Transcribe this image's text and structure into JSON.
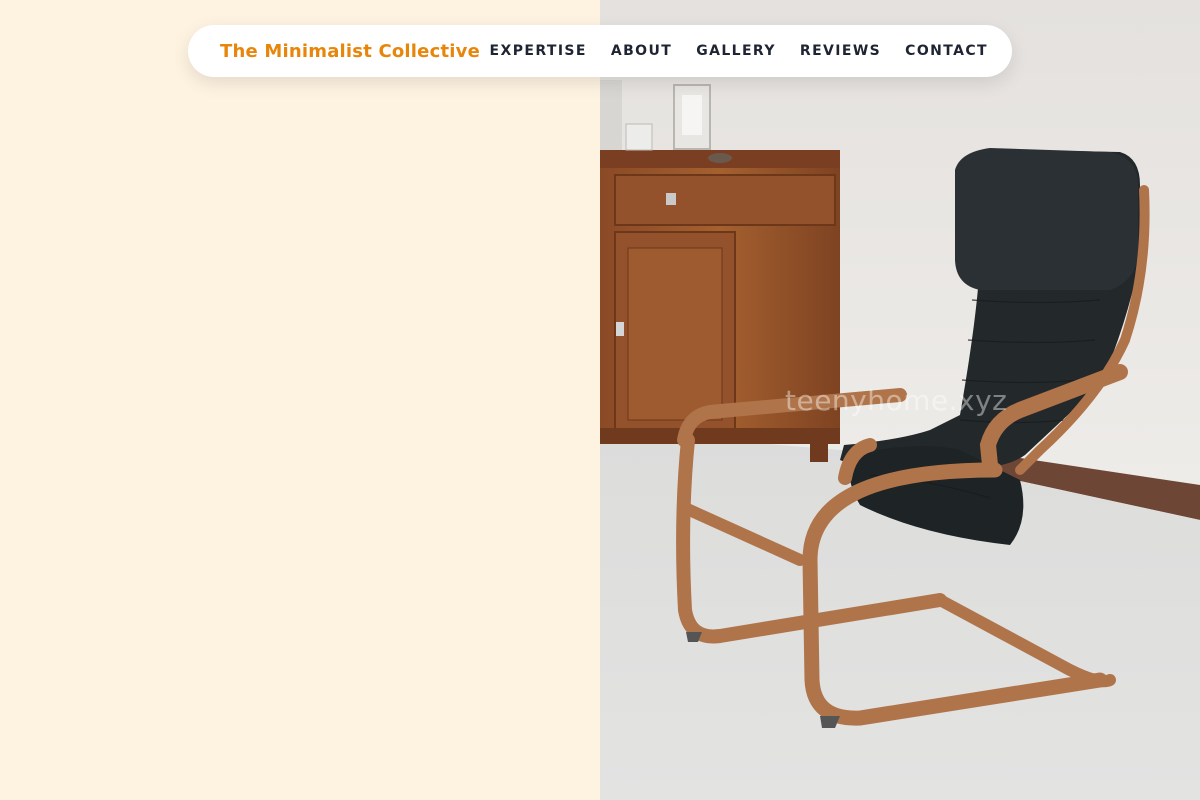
{
  "header": {
    "brand": "The Minimalist Collective",
    "nav": [
      {
        "label": "EXPERTISE"
      },
      {
        "label": "ABOUT"
      },
      {
        "label": "GALLERY"
      },
      {
        "label": "REVIEWS"
      },
      {
        "label": "CONTACT"
      }
    ]
  },
  "hero": {
    "watermark": "teenyhome.xyz"
  },
  "colors": {
    "brand": "#e8860c",
    "nav_text": "#1f2433",
    "left_panel_bg": "#fef2e1",
    "nav_bg": "#ffffff"
  }
}
